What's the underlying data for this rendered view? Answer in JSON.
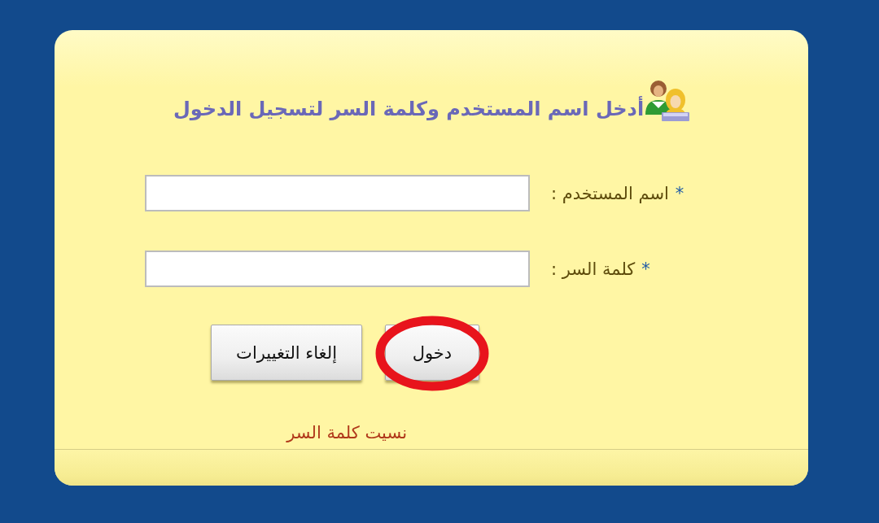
{
  "title": {
    "text": "أدخل اسم المستخدم وكلمة السر لتسجيل الدخول"
  },
  "form": {
    "fields": [
      {
        "mark": "*",
        "label": "اسم المستخدم :"
      },
      {
        "mark": "*",
        "label": "كلمة السر :"
      }
    ]
  },
  "buttons": [
    {
      "label": "دخول",
      "circled": true
    },
    {
      "label": "إلغاء التغييرات",
      "circled": false
    }
  ],
  "link": {
    "text": "نسيت كلمة السر"
  }
}
